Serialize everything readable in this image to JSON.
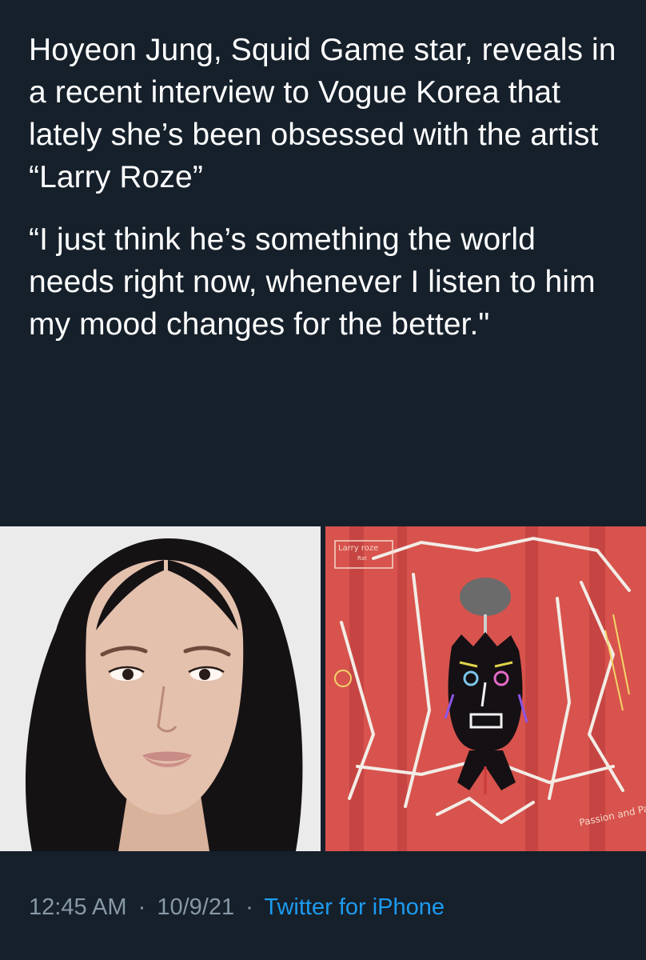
{
  "tweet": {
    "paragraphs": [
      "Hoyeon Jung, Squid Game star, reveals in a recent interview to Vogue Korea that lately she’s been obsessed with the artist “Larry Roze”",
      "“I just think he’s something the world needs right now, whenever I listen to him my mood changes for the better.\""
    ]
  },
  "media": {
    "artwork_text": {
      "corner_label": "Larry roze",
      "corner_sub": "Rat",
      "bottom_right": "Passion and Pain"
    }
  },
  "meta": {
    "time": "12:45 AM",
    "separator": "·",
    "date": "10/9/21",
    "source": "Twitter for iPhone"
  },
  "colors": {
    "background": "#15202b",
    "text": "#ffffff",
    "muted": "#8899a6",
    "link": "#1d9bf0",
    "artwork_red": "#d9544e"
  }
}
